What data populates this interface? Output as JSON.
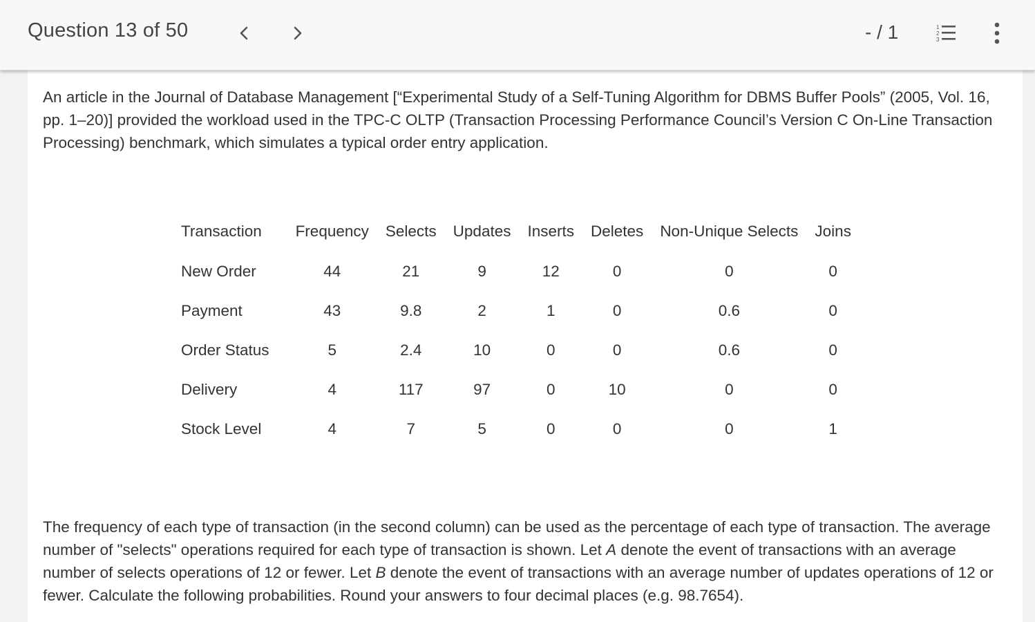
{
  "header": {
    "question_label": "Question 13 of 50",
    "score": "- / 1",
    "icons": {
      "prev": "chevron-left-icon",
      "next": "chevron-right-icon",
      "list": "numbered-list-icon",
      "more": "more-vertical-icon"
    }
  },
  "intro": "An article in the Journal of Database Management [“Experimental Study of a Self-Tuning Algorithm for DBMS Buffer Pools” (2005, Vol. 16, pp. 1–20)] provided the workload used in the TPC-C OLTP (Transaction Processing Performance Council’s Version C On-Line Transaction Processing) benchmark, which simulates a typical order entry application.",
  "table": {
    "headers": [
      "Transaction",
      "Frequency",
      "Selects",
      "Updates",
      "Inserts",
      "Deletes",
      "Non-Unique Selects",
      "Joins"
    ],
    "rows": [
      [
        "New Order",
        "44",
        "21",
        "9",
        "12",
        "0",
        "0",
        "0"
      ],
      [
        "Payment",
        "43",
        "9.8",
        "2",
        "1",
        "0",
        "0.6",
        "0"
      ],
      [
        "Order Status",
        "5",
        "2.4",
        "10",
        "0",
        "0",
        "0.6",
        "0"
      ],
      [
        "Delivery",
        "4",
        "117",
        "97",
        "0",
        "10",
        "0",
        "0"
      ],
      [
        "Stock Level",
        "4",
        "7",
        "5",
        "0",
        "0",
        "0",
        "1"
      ]
    ]
  },
  "question": {
    "part1": "The frequency of each type of transaction (in the second column) can be used as the percentage of each type of transaction. The average number of \"selects\" operations required for each type of transaction is shown. Let ",
    "var_a": "A",
    "part2": " denote the event of transactions with an average number of selects operations of 12 or fewer. Let ",
    "var_b": "B",
    "part3": " denote the event of transactions with an average number of updates operations of 12 or fewer. Calculate the following probabilities. Round your answers to four decimal places (e.g. 98.7654)."
  },
  "colors": {
    "topbar_bg": "#f8f8f8",
    "page_bg": "#f2f2f2",
    "content_bg": "#ffffff",
    "text": "#333333",
    "icon": "#555555"
  }
}
